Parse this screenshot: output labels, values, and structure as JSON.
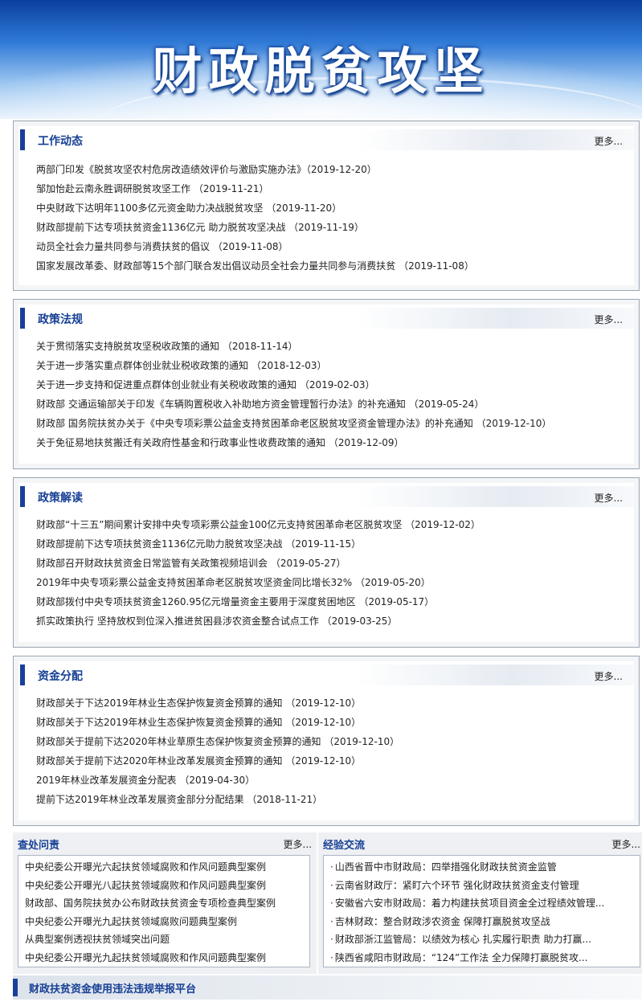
{
  "banner": {
    "title": "财政脱贫攻坚"
  },
  "sections": [
    {
      "title": "工作动态",
      "more": "更多...",
      "items": [
        "两部门印发《脱贫攻坚农村危房改造绩效评价与激励实施办法》（2019-12-20）",
        "邹加怡赴云南永胜调研脱贫攻坚工作 （2019-11-21）",
        "中央财政下达明年1100多亿元资金助力决战脱贫攻坚 （2019-11-20）",
        "财政部提前下达专项扶贫资金1136亿元 助力脱贫攻坚决战 （2019-11-19）",
        "动员全社会力量共同参与消费扶贫的倡议 （2019-11-08）",
        "国家发展改革委、财政部等15个部门联合发出倡议动员全社会力量共同参与消费扶贫 （2019-11-08）"
      ]
    },
    {
      "title": "政策法规",
      "more": "更多...",
      "items": [
        "关于贯彻落实支持脱贫攻坚税收政策的通知 （2018-11-14）",
        "关于进一步落实重点群体创业就业税收政策的通知 （2018-12-03）",
        "关于进一步支持和促进重点群体创业就业有关税收政策的通知 （2019-02-03）",
        "财政部 交通运输部关于印发《车辆购置税收入补助地方资金管理暂行办法》的补充通知 （2019-05-24）",
        "财政部 国务院扶贫办关于《中央专项彩票公益金支持贫困革命老区脱贫攻坚资金管理办法》的补充通知 （2019-12-10）",
        "关于免征易地扶贫搬迁有关政府性基金和行政事业性收费政策的通知 （2019-12-09）"
      ]
    },
    {
      "title": "政策解读",
      "more": "更多...",
      "items": [
        "财政部“十三五”期间累计安排中央专项彩票公益金100亿元支持贫困革命老区脱贫攻坚 （2019-12-02）",
        "财政部提前下达专项扶贫资金1136亿元助力脱贫攻坚决战 （2019-11-15）",
        "财政部召开财政扶贫资金日常监管有关政策视频培训会 （2019-05-27）",
        "2019年中央专项彩票公益金支持贫困革命老区脱贫攻坚资金同比增长32% （2019-05-20）",
        "财政部拨付中央专项扶贫资金1260.95亿元增量资金主要用于深度贫困地区 （2019-05-17）",
        "抓实政策执行 坚持放权到位深入推进贫困县涉农资金整合试点工作 （2019-03-25）"
      ]
    },
    {
      "title": "资金分配",
      "more": "更多...",
      "items": [
        "财政部关于下达2019年林业生态保护恢复资金预算的通知 （2019-12-10）",
        "财政部关于下达2019年林业生态保护恢复资金预算的通知 （2019-12-10）",
        "财政部关于提前下达2020年林业草原生态保护恢复资金预算的通知 （2019-12-10）",
        "财政部关于提前下达2020年林业改革发展资金预算的通知 （2019-12-10）",
        "2019年林业改革发展资金分配表 （2019-04-30）",
        "提前下达2019年林业改革发展资金部分分配结果 （2018-11-21）"
      ]
    }
  ],
  "panels": [
    {
      "title": "查处问责",
      "more": "更多...",
      "items": [
        "中央纪委公开曝光六起扶贫领域腐败和作风问题典型案例",
        "中央纪委公开曝光八起扶贫领域腐败和作风问题典型案例",
        "财政部、国务院扶贫办公布财政扶贫资金专项检查典型案例",
        "中央纪委公开曝光九起扶贫领域腐败问题典型案例",
        "从典型案例透视扶贫领域突出问题",
        "中央纪委公开曝光九起扶贫领域腐败和作风问题典型案例"
      ]
    },
    {
      "title": "经验交流",
      "more": "更多...",
      "items": [
        "山西省晋中市财政局：四举措强化财政扶贫资金监管",
        "云南省财政厅：紧盯六个环节 强化财政扶贫资金支付管理",
        "安徽省六安市财政局：着力构建扶贫项目资金全过程绩效管理...",
        "吉林财政：整合财政涉农资金 保障打赢脱贫攻坚战",
        "财政部浙江监管局：以绩效为核心 扎实履行职责 助力打赢...",
        "陕西省咸阳市财政局：“124”工作法 全力保障打赢脱贫攻..."
      ]
    }
  ],
  "footer": {
    "title": "财政扶贫资金使用违法违规举报平台"
  }
}
